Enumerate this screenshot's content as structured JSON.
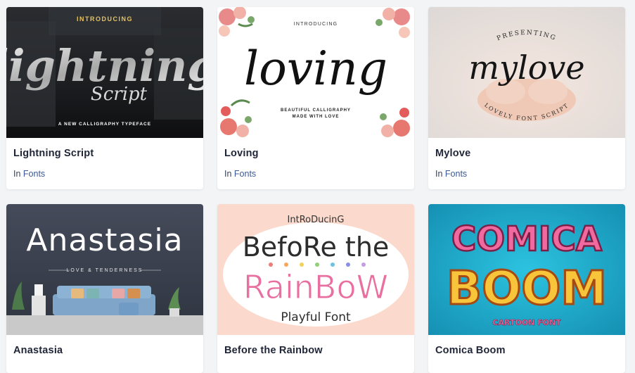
{
  "cards": [
    {
      "title": "Lightning Script",
      "meta_prefix": "In",
      "category": "Fonts",
      "thumb": {
        "kicker": "INTRODUCING",
        "headline": "lightning",
        "subhead": "Script",
        "tagline": "A NEW CALLIGRAPHY TYPEFACE",
        "bg": "#1d1f22",
        "accent": "#e8c25a"
      }
    },
    {
      "title": "Loving",
      "meta_prefix": "In",
      "category": "Fonts",
      "thumb": {
        "kicker": "INTRODUCING",
        "headline": "loving",
        "tagline_line1": "BEAUTIFUL CALLIGRAPHY",
        "tagline_line2": "MADE WITH LOVE",
        "bg": "#ffffff",
        "accent": "#e26a6a"
      }
    },
    {
      "title": "Mylove",
      "meta_prefix": "In",
      "category": "Fonts",
      "thumb": {
        "kicker": "PRESENTING",
        "headline": "mylove",
        "tagline": "LOVELY FONT SCRIPT",
        "bg": "#ece9e6"
      }
    },
    {
      "title": "Anastasia",
      "meta_prefix": "In",
      "category": "Fonts",
      "thumb": {
        "headline": "Anastasia",
        "tagline": "LOVE & TENDERNESS",
        "bg": "#3b4150",
        "sofa": "#7fa6c9"
      }
    },
    {
      "title": "Before the Rainbow",
      "meta_prefix": "In",
      "category": "Fonts",
      "thumb": {
        "kicker": "IntRoDucinG",
        "headline_line1": "BefoRe the",
        "headline_line2": "RainBoW",
        "tagline": "Playful Font",
        "bg": "#fbd9cc"
      }
    },
    {
      "title": "Comica Boom",
      "meta_prefix": "In",
      "category": "Fonts",
      "thumb": {
        "headline_line1": "COMICA",
        "headline_line2": "BOOM",
        "tagline": "CARTOON FONT",
        "bg": "#1ba8c9"
      }
    }
  ]
}
